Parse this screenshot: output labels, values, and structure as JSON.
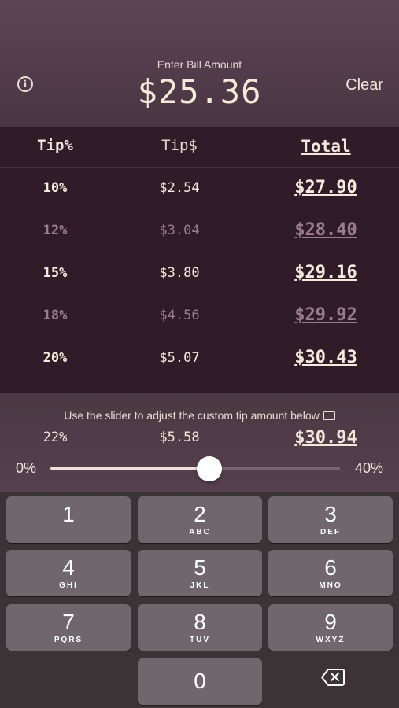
{
  "header": {
    "enter_label": "Enter Bill Amount",
    "amount": "$25.36",
    "clear_label": "Clear",
    "info_icon": "info-icon"
  },
  "table": {
    "headers": [
      "Tip%",
      "Tip$",
      "Total"
    ],
    "rows": [
      {
        "pct": "10%",
        "tip": "$2.54",
        "total": "$27.90",
        "style": "bright"
      },
      {
        "pct": "12%",
        "tip": "$3.04",
        "total": "$28.40",
        "style": "dim"
      },
      {
        "pct": "15%",
        "tip": "$3.80",
        "total": "$29.16",
        "style": "bright"
      },
      {
        "pct": "18%",
        "tip": "$4.56",
        "total": "$29.92",
        "style": "dim"
      },
      {
        "pct": "20%",
        "tip": "$5.07",
        "total": "$30.43",
        "style": "bright"
      }
    ]
  },
  "custom": {
    "hint": "Use the slider to adjust the custom tip amount below",
    "hint_icon": "monitor-icon",
    "pct": "22%",
    "tip": "$5.58",
    "total": "$30.94",
    "slider_min": "0%",
    "slider_max": "40%",
    "slider_value_fraction": 0.55
  },
  "keypad": {
    "keys": [
      {
        "num": "1",
        "letters": ""
      },
      {
        "num": "2",
        "letters": "ABC"
      },
      {
        "num": "3",
        "letters": "DEF"
      },
      {
        "num": "4",
        "letters": "GHI"
      },
      {
        "num": "5",
        "letters": "JKL"
      },
      {
        "num": "6",
        "letters": "MNO"
      },
      {
        "num": "7",
        "letters": "PQRS"
      },
      {
        "num": "8",
        "letters": "TUV"
      },
      {
        "num": "9",
        "letters": "WXYZ"
      },
      {
        "num": "0",
        "letters": ""
      }
    ],
    "backspace_icon": "backspace-icon"
  },
  "colors": {
    "header_bg": "#5e4453",
    "table_bg": "#2f1c28",
    "text_bright": "#f6eadc",
    "text_dim": "#9a7c8c",
    "key_bg": "#6f676b"
  }
}
